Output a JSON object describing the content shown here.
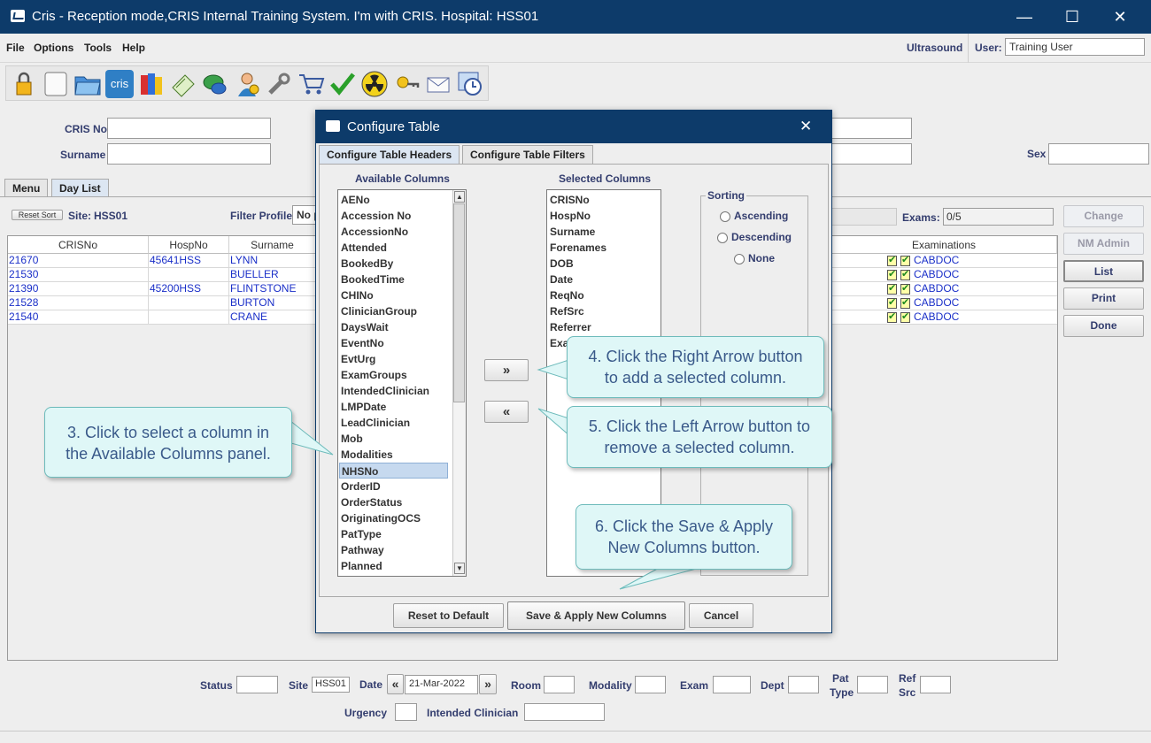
{
  "window": {
    "title": "Cris - Reception mode,CRIS Internal Training System. I'm with CRIS.   Hospital: HSS01",
    "minimize": "—",
    "maximize": "☐",
    "close": "✕"
  },
  "menu": [
    "File",
    "Options",
    "Tools",
    "Help"
  ],
  "header": {
    "modality": "Ultrasound",
    "user_label": "User:",
    "user_value": "Training User"
  },
  "toolbar_icons": [
    "lock-icon",
    "blank-page-icon",
    "folder-icon",
    "cris-icon",
    "books-icon",
    "scroll-icon",
    "chat-icon",
    "person-info-icon",
    "wrench-icon",
    "cart-icon",
    "checkmark-icon",
    "radiation-icon",
    "key-icon",
    "envelope-icon",
    "clock-icon"
  ],
  "toolbar_cris_label": "cris",
  "search": {
    "cris_no_label": "CRIS No",
    "surname_label": "Surname",
    "sex_label": "Sex"
  },
  "tabs": [
    "Menu",
    "Day List"
  ],
  "daylist": {
    "reset_sort": "Reset Sort",
    "site_label": "Site:",
    "site_value": "HSS01",
    "filter_profile_label": "Filter Profile",
    "filter_profile_value": "No p",
    "exams_label": "Exams:",
    "exams_value": "0/5"
  },
  "grid": {
    "headers": [
      "CRISNo",
      "HospNo",
      "Surname",
      "Examinations"
    ],
    "rows": [
      {
        "crisno": "21670",
        "hospno": "45641HSS",
        "surname": "LYNN",
        "exam": "CABDOC"
      },
      {
        "crisno": "21530",
        "hospno": "",
        "surname": "BUELLER",
        "exam": "CABDOC"
      },
      {
        "crisno": "21390",
        "hospno": "45200HSS",
        "surname": "FLINTSTONE",
        "exam": "CABDOC"
      },
      {
        "crisno": "21528",
        "hospno": "",
        "surname": "BURTON",
        "exam": "CABDOC"
      },
      {
        "crisno": "21540",
        "hospno": "",
        "surname": "CRANE",
        "exam": "CABDOC"
      }
    ]
  },
  "side_buttons": [
    {
      "label": "Change",
      "enabled": false
    },
    {
      "label": "NM Admin",
      "enabled": false
    },
    {
      "label": "List",
      "enabled": true
    },
    {
      "label": "Print",
      "enabled": true
    },
    {
      "label": "Done",
      "enabled": true
    }
  ],
  "footer": {
    "status_label": "Status",
    "site_label": "Site",
    "site_value": "HSS01",
    "date_label": "Date",
    "date_value": "21-Mar-2022",
    "room_label": "Room",
    "modality_label": "Modality",
    "exam_label": "Exam",
    "dept_label": "Dept",
    "pat_type_label_1": "Pat",
    "pat_type_label_2": "Type",
    "ref_src_label_1": "Ref",
    "ref_src_label_2": "Src",
    "urgency_label": "Urgency",
    "intended_clinician_label": "Intended Clinician"
  },
  "dialog": {
    "title": "Configure Table",
    "close": "✕",
    "tabs": [
      "Configure Table Headers",
      "Configure Table Filters"
    ],
    "available_title": "Available Columns",
    "selected_title": "Selected Columns",
    "available_columns": [
      "AENo",
      "Accession No",
      "AccessionNo",
      "Attended",
      "BookedBy",
      "BookedTime",
      "CHINo",
      "ClinicianGroup",
      "DaysWait",
      "EventNo",
      "EvtUrg",
      "ExamGroups",
      "IntendedClinician",
      "LMPDate",
      "LeadClinician",
      "Mob",
      "Modalities",
      "NHSNo",
      "OrderID",
      "OrderStatus",
      "OriginatingOCS",
      "PatType",
      "Pathway",
      "Planned"
    ],
    "selected_item": "NHSNo",
    "selected_columns": [
      "CRISNo",
      "HospNo",
      "Surname",
      "Forenames",
      "DOB",
      "Date",
      "ReqNo",
      "RefSrc",
      "Referrer",
      "Exa"
    ],
    "sorting_title": "Sorting",
    "sort_options": [
      "Ascending",
      "Descending",
      "None"
    ],
    "right_arrow": "»",
    "left_arrow": "«",
    "buttons": {
      "reset": "Reset to Default",
      "save": "Save & Apply New Columns",
      "cancel": "Cancel"
    }
  },
  "callouts": {
    "c3_line1": "3. Click to select a column in",
    "c3_line2": "the Available Columns panel.",
    "c4_line1": "4. Click the Right Arrow button",
    "c4_line2": "to add a selected column.",
    "c5_line1": "5. Click the Left Arrow button to",
    "c5_line2": "remove a selected column.",
    "c6_line1": "6. Click the Save & Apply",
    "c6_line2": "New Columns button."
  }
}
